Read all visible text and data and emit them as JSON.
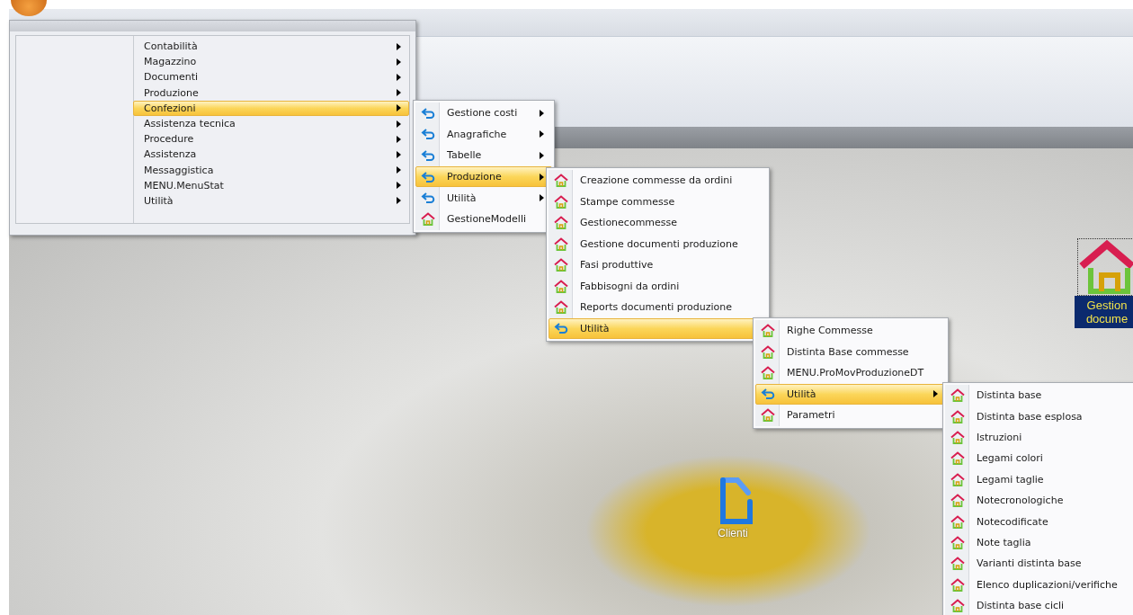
{
  "menus": [
    {
      "icons": false,
      "items": [
        {
          "label": "Contabilità",
          "kind": "submenu",
          "selected": false
        },
        {
          "label": "Magazzino",
          "kind": "submenu",
          "selected": false
        },
        {
          "label": "Documenti",
          "kind": "submenu",
          "selected": false
        },
        {
          "label": "Produzione",
          "kind": "submenu",
          "selected": false
        },
        {
          "label": "Confezioni",
          "kind": "submenu",
          "selected": true
        },
        {
          "label": "Assistenza tecnica",
          "kind": "submenu",
          "selected": false
        },
        {
          "label": "Procedure",
          "kind": "submenu",
          "selected": false
        },
        {
          "label": "Assistenza",
          "kind": "submenu",
          "selected": false
        },
        {
          "label": "Messaggistica",
          "kind": "submenu",
          "selected": false
        },
        {
          "label": "MENU.MenuStat",
          "kind": "submenu",
          "selected": false
        },
        {
          "label": "Utilità",
          "kind": "submenu",
          "selected": false
        }
      ]
    },
    {
      "icons": true,
      "items": [
        {
          "label": "Gestione costi",
          "kind": "submenu",
          "selected": false
        },
        {
          "label": "Anagrafiche",
          "kind": "submenu",
          "selected": false
        },
        {
          "label": "Tabelle",
          "kind": "submenu",
          "selected": false
        },
        {
          "label": "Produzione",
          "kind": "submenu",
          "selected": true
        },
        {
          "label": "Utilità",
          "kind": "submenu",
          "selected": false
        },
        {
          "label": "GestioneModelli",
          "kind": "command",
          "selected": false
        }
      ]
    },
    {
      "icons": true,
      "items": [
        {
          "label": "Creazione commesse da ordini",
          "kind": "command",
          "selected": false
        },
        {
          "label": "Stampe commesse",
          "kind": "command",
          "selected": false
        },
        {
          "label": "Gestionecommesse",
          "kind": "command",
          "selected": false
        },
        {
          "label": "Gestione documenti produzione",
          "kind": "command",
          "selected": false
        },
        {
          "label": "Fasi produttive",
          "kind": "command",
          "selected": false
        },
        {
          "label": "Fabbisogni da ordini",
          "kind": "command",
          "selected": false
        },
        {
          "label": "Reports documenti produzione",
          "kind": "command",
          "selected": false
        },
        {
          "label": "Utilità",
          "kind": "submenu",
          "selected": true
        }
      ]
    },
    {
      "icons": true,
      "items": [
        {
          "label": "Righe Commesse",
          "kind": "command",
          "selected": false
        },
        {
          "label": "Distinta Base commesse",
          "kind": "command",
          "selected": false
        },
        {
          "label": "MENU.ProMovProduzioneDT",
          "kind": "command",
          "selected": false
        },
        {
          "label": "Utilità",
          "kind": "submenu",
          "selected": true
        },
        {
          "label": "Parametri",
          "kind": "command",
          "selected": false
        }
      ]
    },
    {
      "icons": true,
      "items": [
        {
          "label": "Distinta base",
          "kind": "command",
          "selected": false
        },
        {
          "label": "Distinta base esplosa",
          "kind": "command",
          "selected": false
        },
        {
          "label": "Istruzioni",
          "kind": "command",
          "selected": false
        },
        {
          "label": "Legami colori",
          "kind": "command",
          "selected": false
        },
        {
          "label": "Legami taglie",
          "kind": "command",
          "selected": false
        },
        {
          "label": "Notecronologiche",
          "kind": "command",
          "selected": false
        },
        {
          "label": "Notecodificate",
          "kind": "command",
          "selected": false
        },
        {
          "label": "Note taglia",
          "kind": "command",
          "selected": false
        },
        {
          "label": "Varianti distinta base",
          "kind": "command",
          "selected": false
        },
        {
          "label": "Elenco duplicazioni/verifiche",
          "kind": "command",
          "selected": false
        },
        {
          "label": "Distinta base cicli",
          "kind": "command",
          "selected": false
        }
      ]
    }
  ],
  "desktop_icons": [
    {
      "kind": "house",
      "lines": [
        "Gestion",
        "docume"
      ]
    },
    {
      "kind": "document",
      "lines": [
        "Clienti"
      ]
    }
  ]
}
